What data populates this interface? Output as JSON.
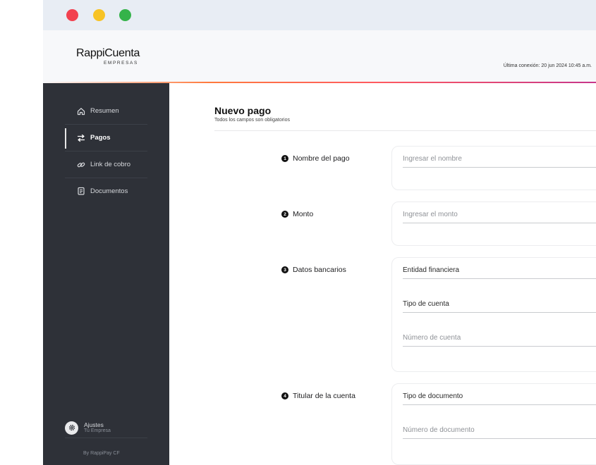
{
  "window": {
    "controls": [
      "close",
      "minimize",
      "maximize"
    ]
  },
  "header": {
    "logo_name": "RappiCuenta",
    "logo_sub": "EMPRESAS",
    "last_connection": "Última conexión: 20 jun 2024 10:45 a.m."
  },
  "sidebar": {
    "items": [
      {
        "label": "Resumen",
        "icon": "home-icon"
      },
      {
        "label": "Pagos",
        "icon": "transfer-arrows-icon",
        "active": true
      },
      {
        "label": "Link de cobro",
        "icon": "link-icon"
      },
      {
        "label": "Documentos",
        "icon": "document-icon"
      }
    ],
    "settings_label": "Ajustes",
    "settings_sub": "Tu Empresa",
    "footer": "By RappiPay CF"
  },
  "main": {
    "title": "Nuevo pago",
    "subtitle": "Todos los campos son obligatorios",
    "sections": [
      {
        "number": "1",
        "label": "Nombre del pago",
        "fields": [
          {
            "text": "Ingresar el nombre",
            "type": "placeholder"
          }
        ]
      },
      {
        "number": "2",
        "label": "Monto",
        "fields": [
          {
            "text": "Ingresar el monto",
            "type": "placeholder"
          }
        ]
      },
      {
        "number": "3",
        "label": "Datos bancarios",
        "fields": [
          {
            "text": "Entidad financiera",
            "type": "select"
          },
          {
            "text": "Tipo de cuenta",
            "type": "select"
          },
          {
            "text": "Número de cuenta",
            "type": "placeholder"
          }
        ]
      },
      {
        "number": "4",
        "label": "Titular de la cuenta",
        "fields": [
          {
            "text": "Tipo de documento",
            "type": "select"
          },
          {
            "text": "Número de documento",
            "type": "placeholder"
          }
        ]
      }
    ]
  },
  "colors": {
    "sidebar_bg": "#2e3138",
    "accent_gradient": [
      "#ff7a3d",
      "#ff5a5f",
      "#c7368a"
    ],
    "traffic_red": "#f2414f",
    "traffic_yellow": "#f7c325",
    "traffic_green": "#35b34a"
  }
}
